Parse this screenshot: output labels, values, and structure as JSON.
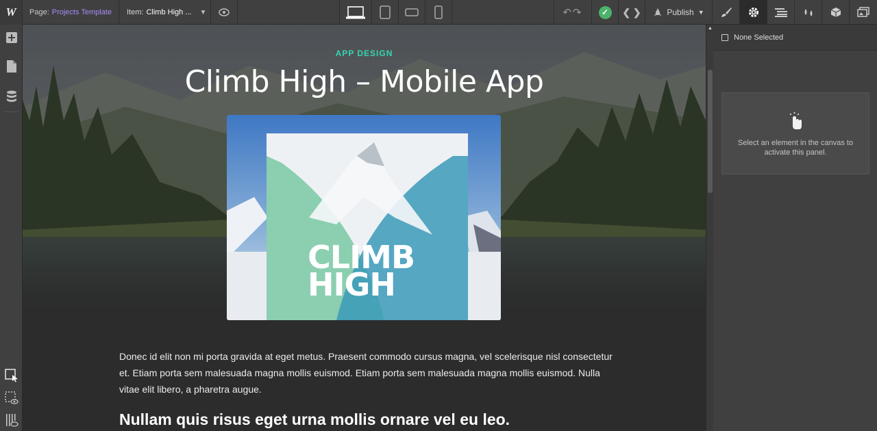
{
  "topbar": {
    "logo": "W",
    "page_label": "Page:",
    "page_value": "Projects Template",
    "item_label": "Item:",
    "item_value": "Climb High ...",
    "publish_label": "Publish"
  },
  "canvas": {
    "eyebrow": "APP DESIGN",
    "title": "Climb High – Mobile App",
    "cover_line1": "CLIMB",
    "cover_line2": "HIGH",
    "paragraph": "Donec id elit non mi porta gravida at eget metus. Praesent commodo cursus magna, vel scelerisque nisl consectetur et. Etiam porta sem malesuada magna mollis euismod. Etiam porta sem malesuada magna mollis euismod. Nulla vitae elit libero, a pharetra augue.",
    "subheading": "Nullam quis risus eget urna mollis ornare vel eu leo."
  },
  "panel": {
    "none_selected": "None Selected",
    "hint": "Select an element in the canvas to activate this panel."
  },
  "colors": {
    "accent_teal": "#35d6b0",
    "page_link": "#a78bfa",
    "check_green": "#4cb26b"
  }
}
